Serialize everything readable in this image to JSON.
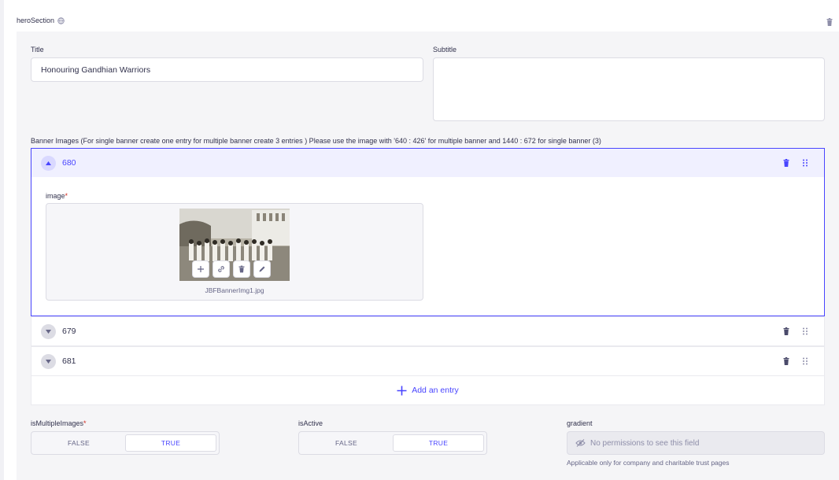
{
  "section": {
    "title": "heroSection"
  },
  "title_field": {
    "label": "Title",
    "value": "Honouring Gandhian Warriors"
  },
  "subtitle_field": {
    "label": "Subtitle",
    "value": ""
  },
  "banner": {
    "label": "Banner Images (For single banner create one entry for multiple banner create 3 entries ) Please use the image with '640 : 426' for multiple banner and 1440 : 672 for single banner (3)",
    "entries": [
      {
        "title": "680",
        "expanded": true
      },
      {
        "title": "679",
        "expanded": false
      },
      {
        "title": "681",
        "expanded": false
      }
    ],
    "image_label": "image",
    "required_mark": "*",
    "file_name": "JBFBannerImg1.jpg",
    "add_entry": "Add an entry"
  },
  "is_multiple": {
    "label": "isMultipleImages",
    "required_mark": "*",
    "off": "FALSE",
    "on": "TRUE"
  },
  "is_active": {
    "label": "isActive",
    "off": "FALSE",
    "on": "TRUE"
  },
  "gradient": {
    "label": "gradient",
    "placeholder": "No permissions to see this field",
    "hint": "Applicable only for company and charitable trust pages"
  },
  "colors": {
    "accent": "#4945ff",
    "border": "#dcdce4",
    "panel": "#f5f5f7"
  }
}
